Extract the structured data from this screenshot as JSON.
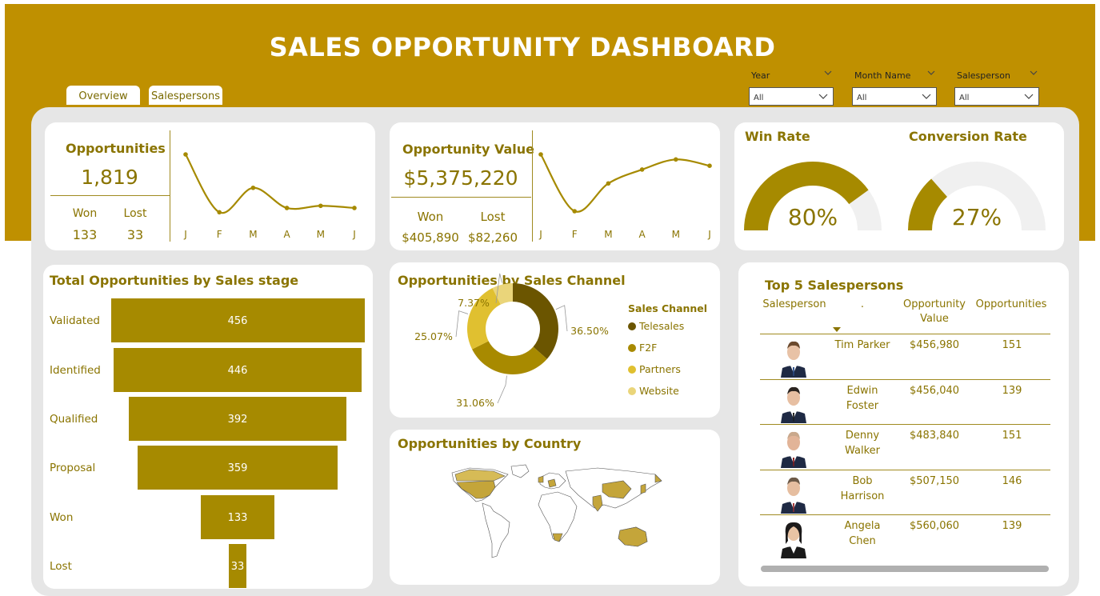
{
  "header": {
    "title": "SALES OPPORTUNITY DASHBOARD"
  },
  "tabs": [
    {
      "label": "Overview"
    },
    {
      "label": "Salespersons"
    }
  ],
  "slicers": [
    {
      "label": "Year",
      "value": "All"
    },
    {
      "label": "Month Name",
      "value": "All"
    },
    {
      "label": "Salesperson",
      "value": "All"
    }
  ],
  "kpi_opportunities": {
    "title": "Opportunities",
    "value": "1,819",
    "won_label": "Won",
    "won_value": "133",
    "lost_label": "Lost",
    "lost_value": "33"
  },
  "kpi_value": {
    "title": "Opportunity Value",
    "value": "$5,375,220",
    "won_label": "Won",
    "won_value": "$405,890",
    "lost_label": "Lost",
    "lost_value": "$82,260"
  },
  "gauges": {
    "win": {
      "title": "Win Rate",
      "value": "80%",
      "fraction": 0.8
    },
    "conversion": {
      "title": "Conversion Rate",
      "value": "27%",
      "fraction": 0.27
    }
  },
  "funnel": {
    "title": "Total Opportunities by Sales stage"
  },
  "channel": {
    "title": "Opportunities by Sales Channel",
    "legend_title": "Sales Channel"
  },
  "country": {
    "title": "Opportunities by Country"
  },
  "top5": {
    "title": "Top 5 Salespersons",
    "headers": {
      "salesperson": "Salesperson",
      "dot": ".",
      "value": "Opportunity Value",
      "opps": "Opportunities"
    },
    "rows": [
      {
        "name": "Tim Parker",
        "value": "$456,980",
        "opps": "151"
      },
      {
        "name": "Edwin Foster",
        "value": "$456,040",
        "opps": "139"
      },
      {
        "name": "Denny Walker",
        "value": "$483,840",
        "opps": "151"
      },
      {
        "name": "Bob Harrison",
        "value": "$507,150",
        "opps": "146"
      },
      {
        "name": "Angela Chen",
        "value": "$560,060",
        "opps": "139"
      }
    ]
  },
  "colors": {
    "accent": "#bf9000",
    "bar": "#a68a00",
    "telesales": "#6b5500",
    "f2f": "#a88a00",
    "partners": "#e0c030",
    "website": "#ead57a"
  },
  "chart_data": [
    {
      "type": "line",
      "name": "opportunities_trend",
      "x": [
        "J",
        "F",
        "M",
        "A",
        "M",
        "J"
      ],
      "values": [
        390,
        255,
        312,
        265,
        270,
        265
      ]
    },
    {
      "type": "line",
      "name": "value_trend",
      "x": [
        "J",
        "F",
        "M",
        "A",
        "M",
        "J"
      ],
      "values": [
        1150000,
        700000,
        920000,
        1030000,
        1110000,
        1060000
      ]
    },
    {
      "type": "bar",
      "name": "funnel",
      "categories": [
        "Validated",
        "Identified",
        "Qualified",
        "Proposal",
        "Won",
        "Lost"
      ],
      "values": [
        456,
        446,
        392,
        359,
        133,
        33
      ]
    },
    {
      "type": "pie",
      "name": "channel",
      "categories": [
        "Telesales",
        "F2F",
        "Partners",
        "Website"
      ],
      "values": [
        36.5,
        31.06,
        25.07,
        7.37
      ],
      "labels": [
        "36.50%",
        "31.06%",
        "25.07%",
        "7.37%"
      ]
    }
  ]
}
